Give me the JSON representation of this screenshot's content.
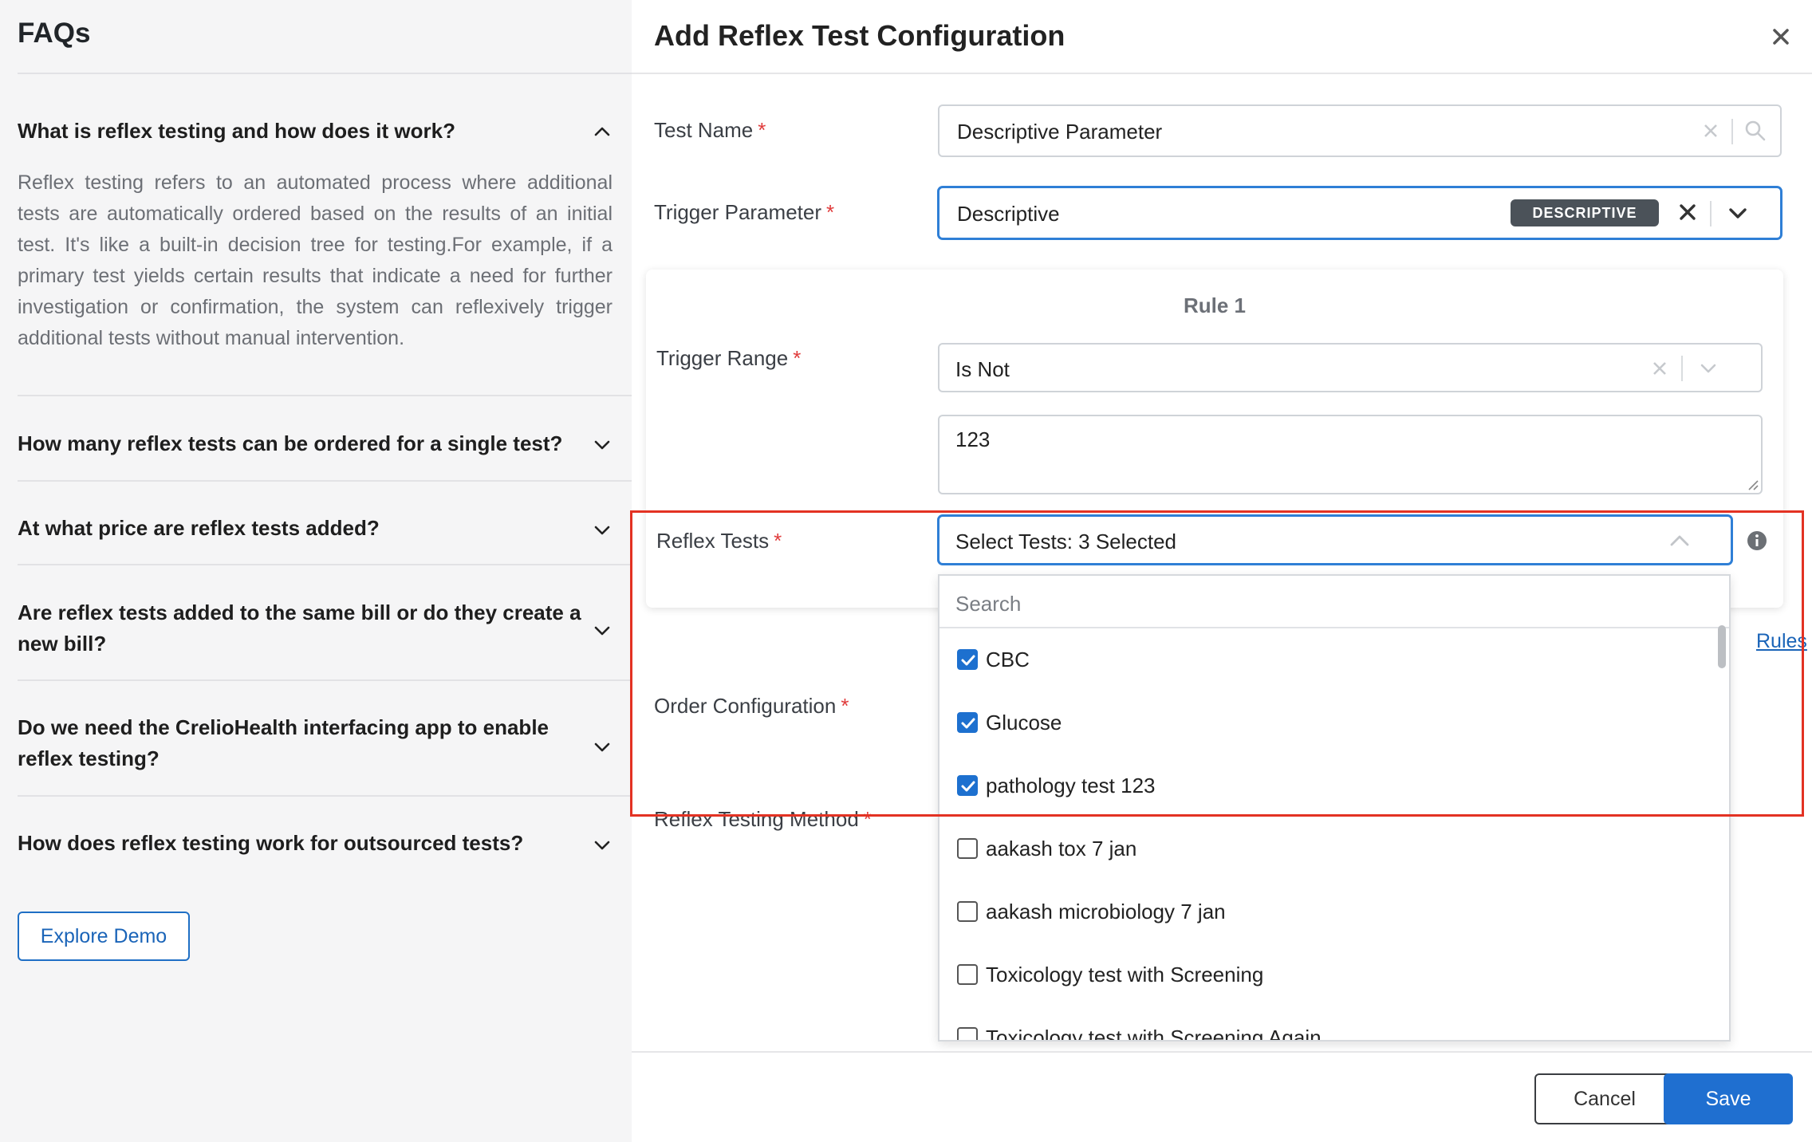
{
  "faq": {
    "title": "FAQs",
    "items": [
      {
        "question": "What is reflex testing and how does it work?",
        "expanded": true,
        "answer": "Reflex testing refers to an automated process where additional tests are automatically ordered based on the results of an initial test. It's like a built-in decision tree for testing.For example, if a primary test yields certain results that indicate a need for further investigation or confirmation, the system can reflexively trigger additional tests without manual intervention."
      },
      {
        "question": "How many reflex tests can be ordered for a single test?",
        "expanded": false
      },
      {
        "question": "At what price are reflex tests added?",
        "expanded": false
      },
      {
        "question": "Are reflex tests added to the same bill or do they create a new bill?",
        "expanded": false
      },
      {
        "question": "Do we need the CrelioHealth interfacing app to enable reflex testing?",
        "expanded": false
      },
      {
        "question": "How does reflex testing work for outsourced tests?",
        "expanded": false
      }
    ],
    "explore_label": "Explore Demo"
  },
  "modal": {
    "title": "Add Reflex Test Configuration",
    "test_name": {
      "label": "Test Name",
      "value": "Descriptive Parameter"
    },
    "trigger_parameter": {
      "label": "Trigger Parameter",
      "value": "Descriptive",
      "badge": "DESCRIPTIVE"
    },
    "rule": {
      "title": "Rule 1",
      "trigger_range": {
        "label": "Trigger Range",
        "operator": "Is Not",
        "value": "123"
      },
      "reflex_tests": {
        "label": "Reflex Tests",
        "summary": "Select Tests: 3 Selected"
      }
    },
    "rules_link": "Rules",
    "order_configuration_label": "Order Configuration",
    "reflex_testing_method_label": "Reflex Testing Method",
    "dropdown": {
      "search_placeholder": "Search",
      "options": [
        {
          "label": "CBC",
          "checked": true
        },
        {
          "label": "Glucose",
          "checked": true
        },
        {
          "label": "pathology test 123",
          "checked": true
        },
        {
          "label": "aakash tox 7 jan",
          "checked": false
        },
        {
          "label": "aakash microbiology 7 jan",
          "checked": false
        },
        {
          "label": "Toxicology test with Screening",
          "checked": false
        },
        {
          "label": "Toxicology test with Screening Again",
          "checked": false
        }
      ]
    },
    "required_mark": "*",
    "cancel_label": "Cancel",
    "save_label": "Save"
  },
  "colors": {
    "primary": "#1f6fd0",
    "required": "#e03b3b",
    "highlight": "#e33223",
    "badge": "#4b5259"
  }
}
